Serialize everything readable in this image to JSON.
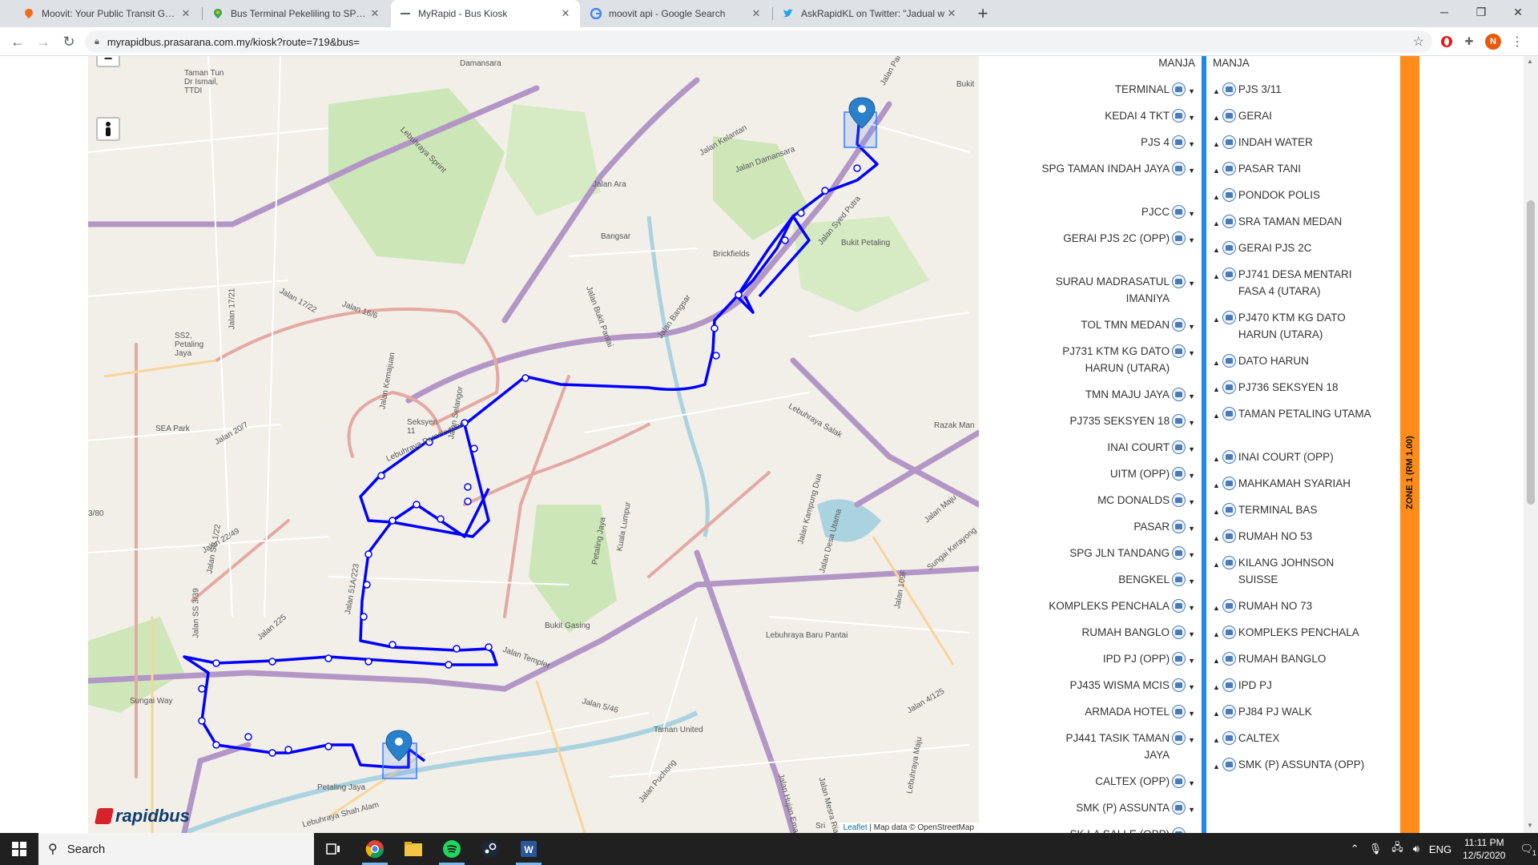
{
  "browser": {
    "tabs": [
      {
        "title": "Moovit: Your Public Transit Guide",
        "icon": "moovit-icon",
        "active": false
      },
      {
        "title": "Bus Terminal Pekeliling to SPG Jln",
        "icon": "google-maps-icon",
        "active": false
      },
      {
        "title": "MyRapid - Bus Kiosk",
        "icon": "myrapid-icon",
        "active": true
      },
      {
        "title": "moovit api - Google Search",
        "icon": "google-icon",
        "active": false
      },
      {
        "title": "AskRapidKL on Twitter: \"Jadual w",
        "icon": "twitter-icon",
        "active": false
      }
    ],
    "url": "myrapidbus.prasarana.com.my/kiosk?route=719&bus=",
    "profile_initial": "N"
  },
  "map": {
    "labels": {
      "damansara": "Damansara",
      "taman_tun": "Taman Tun Dr Ismail, TTDI",
      "bukit": "Bukit",
      "jalan_ara": "Jalan Ara",
      "bangsar": "Bangsar",
      "bukit_petaling": "Bukit Petaling",
      "brickfields": "Brickfields",
      "ss2": "SS2, Petaling Jaya",
      "jalan_17_22": "Jalan 17/22",
      "jalan_16_6": "Jalan 16/6",
      "jalan_17_21": "Jalan 17/21",
      "jalan_kemajuan": "Jalan Kemajuan",
      "jalan_selangor": "Jalan Selangor",
      "jalan_bangsar": "Jalan Bangsar",
      "jalan_bukit_pantai": "Jalan Bukit Pantai",
      "jalan_damansara": "Jalan Damansara",
      "jalan_kelantan": "Jalan Kelantan",
      "jalan_syed_putra": "Jalan Syed Putra",
      "sea_park": "SEA Park",
      "jalan_20_7": "Jalan 20/7",
      "seksyen_11": "Seksyen 11",
      "lebuhraya_persekutuan": "Lebuhraya Persekutuan",
      "lebuhraya_sprint": "Lebuhraya Sprint",
      "lebuhraya_salak": "Lebuhraya Salak",
      "razak_man": "Razak Man",
      "petaling_jaya_road": "Petaling Jaya",
      "kuala_lumpur": "Kuala Lumpur",
      "jalan_kampung_dua": "Jalan Kampung Dua",
      "jalan_desa_utama": "Jalan Desa Utama",
      "jalan_109f": "Jalan 109F",
      "jalan_22_49": "Jalan 22/49",
      "jalan_ss_1_22": "Jalan SS 1/22",
      "jalan_ss_3_39": "Jalan SS 3/39",
      "jalan_51a_223": "Jalan 51A/223",
      "jalan_225": "Jalan 225",
      "bukit_gasing": "Bukit Gasing",
      "jalan_templer": "Jalan Templer",
      "lebuhraya_baru_pantai": "Lebuhraya Baru Pantai",
      "jalan_5_46": "Jalan 5/46",
      "sungai_way": "Sungai Way",
      "taman_united": "Taman United",
      "jalan_4_125": "Jalan 4/125",
      "lebuhraya_maju": "Lebuhraya Maju",
      "jalan_puchong": "Jalan Puchong",
      "jalan_hujan_emas": "Jalan Hujan Emas",
      "jalan_mesra_ria": "Jalan Mesra Ria",
      "petaling_jaya_small": "Petaling Jaya",
      "lebuhraya_shah_alam": "Lebuhraya Shah Alam",
      "sri": "Sri",
      "jalan_pantai_top": "Jalan Pant",
      "lebuhraya_kerinchi": "Sungai Kerayong",
      "jalan_3_80": "3/80",
      "jalan_kuching": "Jalan Maju"
    },
    "zoom_out_label": "−",
    "logo_text": "rapidbus",
    "attribution_link": "Leaflet",
    "attribution_text": " | Map data © OpenStreetMap",
    "route_color": "#0000ff"
  },
  "left_stops": [
    {
      "name": "MANJA"
    },
    {
      "name": "TERMINAL"
    },
    {
      "name": "KEDAI 4 TKT"
    },
    {
      "name": "PJS 4"
    },
    {
      "name": "SPG TAMAN INDAH JAYA"
    },
    {
      "name": "PJCC"
    },
    {
      "name": "GERAI PJS 2C (OPP)"
    },
    {
      "name": "SURAU MADRASATUL IMANIYA"
    },
    {
      "name": "TOL TMN MEDAN"
    },
    {
      "name": "PJ731 KTM KG DATO HARUN (UTARA)"
    },
    {
      "name": "TMN MAJU JAYA"
    },
    {
      "name": "PJ735 SEKSYEN 18"
    },
    {
      "name": "INAI COURT"
    },
    {
      "name": "UITM (OPP)"
    },
    {
      "name": "MC DONALDS"
    },
    {
      "name": "PASAR"
    },
    {
      "name": "SPG JLN TANDANG"
    },
    {
      "name": "BENGKEL"
    },
    {
      "name": "KOMPLEKS PENCHALA"
    },
    {
      "name": "RUMAH BANGLO"
    },
    {
      "name": "IPD PJ (OPP)"
    },
    {
      "name": "PJ435 WISMA MCIS"
    },
    {
      "name": "ARMADA HOTEL"
    },
    {
      "name": "PJ441 TASIK TAMAN JAYA"
    },
    {
      "name": "CALTEX (OPP)"
    },
    {
      "name": "SMK (P) ASSUNTA"
    },
    {
      "name": "SK LA SALLE (OPP)"
    }
  ],
  "right_stops": [
    {
      "name": "MANJA"
    },
    {
      "name": "PJS 3/11"
    },
    {
      "name": "GERAI"
    },
    {
      "name": "INDAH WATER"
    },
    {
      "name": "PASAR TANI"
    },
    {
      "name": "PONDOK POLIS"
    },
    {
      "name": "SRA TAMAN MEDAN"
    },
    {
      "name": "GERAI PJS 2C"
    },
    {
      "name": "PJ741 DESA MENTARI FASA 4 (UTARA)"
    },
    {
      "name": "PJ470 KTM KG DATO HARUN (UTARA)"
    },
    {
      "name": "DATO HARUN"
    },
    {
      "name": "PJ736 SEKSYEN 18"
    },
    {
      "name": "TAMAN PETALING UTAMA"
    },
    {
      "name": "INAI COURT (OPP)"
    },
    {
      "name": "MAHKAMAH SYARIAH"
    },
    {
      "name": "TERMINAL BAS"
    },
    {
      "name": "RUMAH NO 53"
    },
    {
      "name": "KILANG JOHNSON SUISSE"
    },
    {
      "name": "RUMAH NO 73"
    },
    {
      "name": "KOMPLEKS PENCHALA"
    },
    {
      "name": "RUMAH BANGLO"
    },
    {
      "name": "IPD PJ"
    },
    {
      "name": "PJ84 PJ WALK"
    },
    {
      "name": "CALTEX"
    },
    {
      "name": "SMK (P) ASSUNTA (OPP)"
    }
  ],
  "zone_label": "ZONE 1 (RM 1.00)",
  "colors": {
    "zone": "#ff8c1a",
    "direction_bar": "#1e88e5",
    "route": "#0000ff"
  },
  "taskbar": {
    "search_label": "Search",
    "lang": "ENG",
    "time": "11:11 PM",
    "date": "12/5/2020",
    "notifications": "1"
  }
}
